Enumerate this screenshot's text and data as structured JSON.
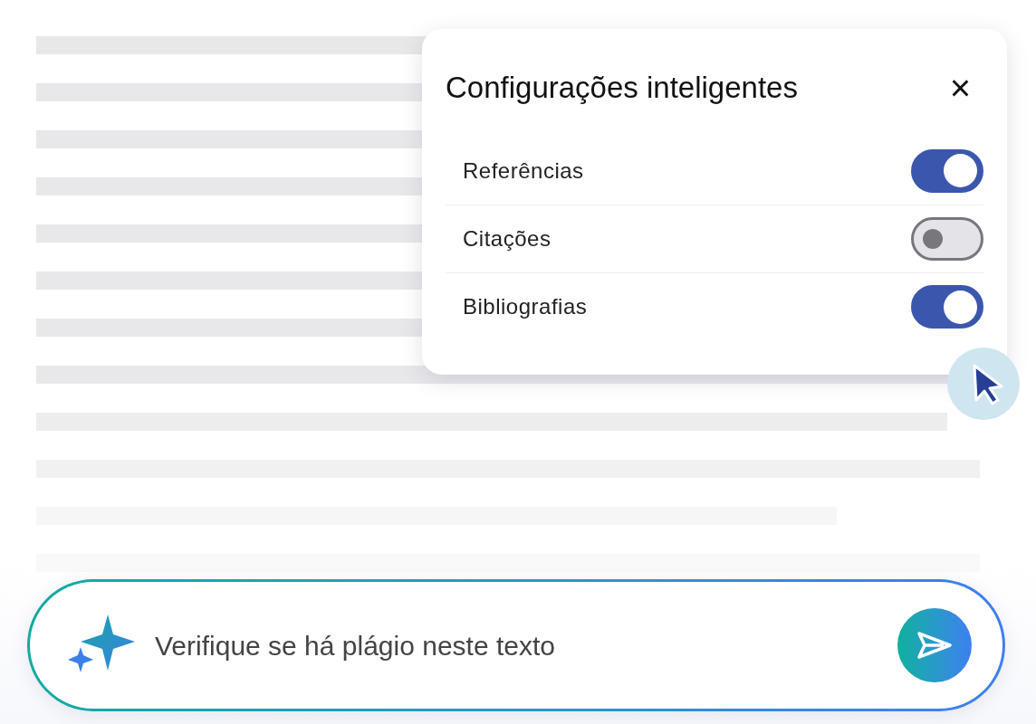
{
  "settings_panel": {
    "title": "Configurações inteligentes",
    "close_label": "×",
    "options": [
      {
        "label": "Referências",
        "on": true
      },
      {
        "label": "Citações",
        "on": false
      },
      {
        "label": "Bibliografias",
        "on": true
      }
    ]
  },
  "prompt": {
    "placeholder": "Verifique se há plágio neste texto"
  }
}
